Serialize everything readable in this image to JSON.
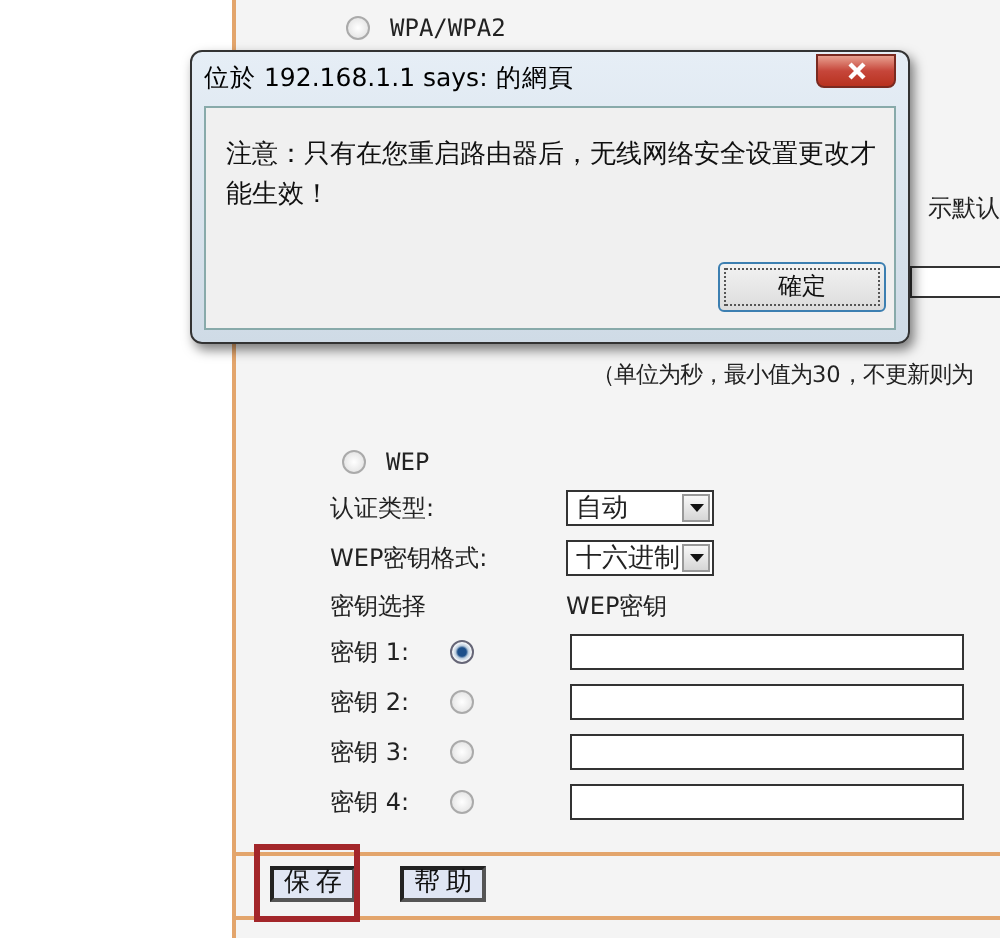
{
  "security_options": [
    {
      "label": "WPA/WPA2",
      "selected": false
    },
    {
      "label": "WEP",
      "selected": false
    }
  ],
  "partial_hint": "示默认",
  "interval_note": "（单位为秒，最小值为30，不更新则为",
  "wep": {
    "fields": [
      {
        "label": "认证类型:",
        "value": "自动"
      },
      {
        "label": "WEP密钥格式:",
        "value": "十六进制"
      }
    ],
    "key_header": [
      "密钥选择",
      "WEP密钥"
    ],
    "keys": [
      {
        "label": "密钥 1:",
        "selected": true
      },
      {
        "label": "密钥 2:",
        "selected": false
      },
      {
        "label": "密钥 3:",
        "selected": false
      },
      {
        "label": "密钥 4:",
        "selected": false
      }
    ]
  },
  "buttons": [
    {
      "label": "保存",
      "highlighted": true
    },
    {
      "label": "帮助",
      "highlighted": false
    }
  ],
  "dialog": {
    "title": "位於 192.168.1.1 says: 的網頁",
    "message": "注意：只有在您重启路由器后，无线网络安全设置更改才能生效！",
    "ok_button": "確定"
  }
}
